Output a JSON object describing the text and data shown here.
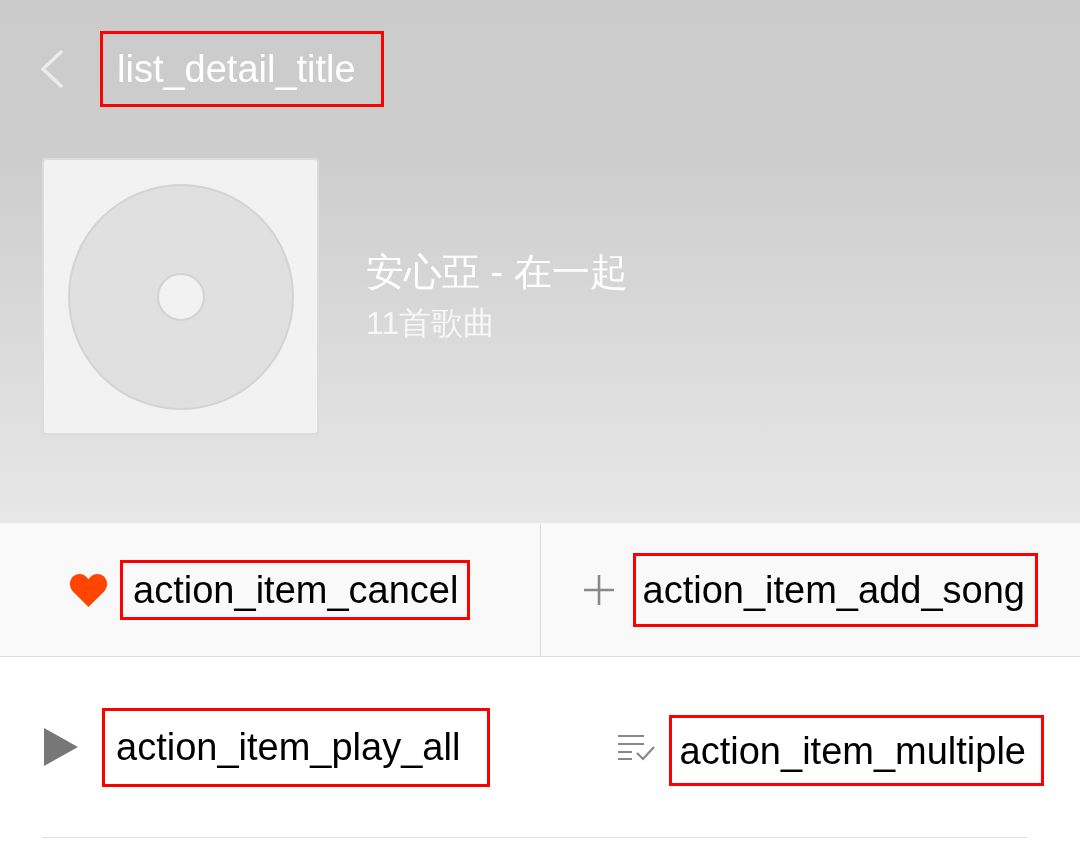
{
  "header": {
    "title": {
      "text": "list_detail_title",
      "outlined": true
    }
  },
  "album": {
    "title": "安心亞 - 在一起",
    "song_count": "11首歌曲"
  },
  "action_bar": [
    {
      "kind": "favorite",
      "label": "action_item_cancel",
      "outlined": true
    },
    {
      "kind": "add",
      "label": "action_item_add_song",
      "outlined": true
    }
  ],
  "list_toolbar": [
    {
      "kind": "play",
      "label": "action_item_play_all",
      "outlined": true
    },
    {
      "kind": "multiselect",
      "label": "action_item_multiple",
      "outlined": true
    }
  ]
}
